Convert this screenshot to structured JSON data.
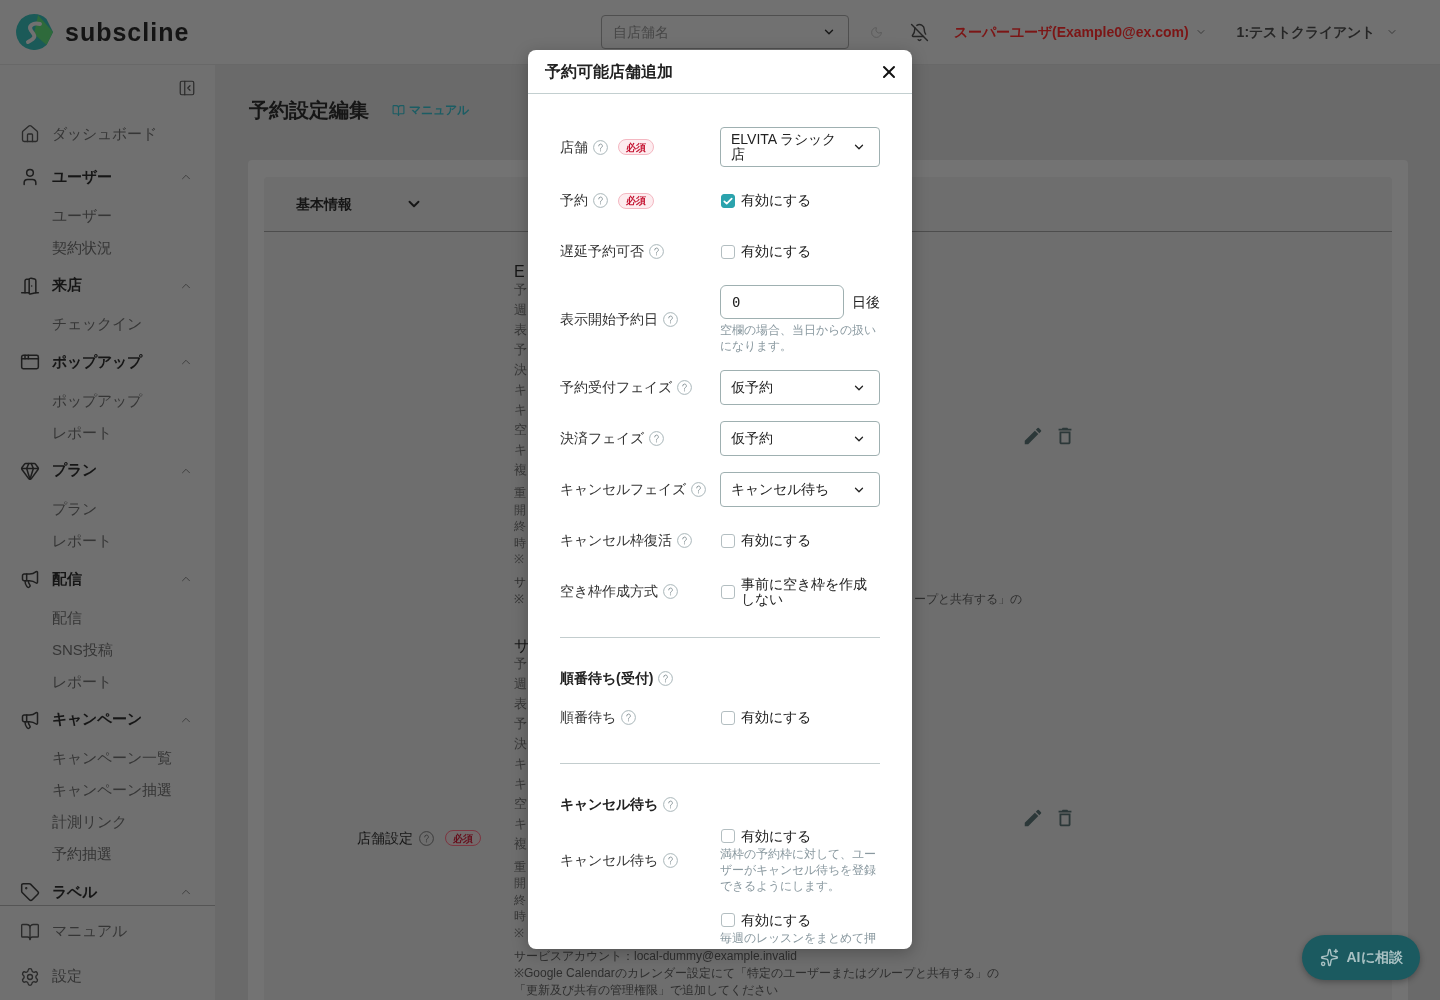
{
  "header": {
    "logo": "subscline",
    "store_select": {
      "placeholder": "自店舗名"
    },
    "user_menu": "スーパーユーザ(Example0@ex.com)",
    "client_menu": "1:テストクライアント"
  },
  "sidebar": {
    "items": [
      {
        "kind": "link",
        "label": "ダッシュボード"
      },
      {
        "kind": "group",
        "label": "ユーザー",
        "expanded": true,
        "children": [
          {
            "label": "ユーザー"
          },
          {
            "label": "契約状況"
          }
        ]
      },
      {
        "kind": "group",
        "label": "来店",
        "expanded": true,
        "children": [
          {
            "label": "チェックイン"
          }
        ]
      },
      {
        "kind": "group",
        "label": "ポップアップ",
        "expanded": true,
        "children": [
          {
            "label": "ポップアップ"
          },
          {
            "label": "レポート"
          }
        ]
      },
      {
        "kind": "group",
        "label": "プラン",
        "expanded": true,
        "children": [
          {
            "label": "プラン"
          },
          {
            "label": "レポート"
          }
        ]
      },
      {
        "kind": "group",
        "label": "配信",
        "expanded": true,
        "children": [
          {
            "label": "配信"
          },
          {
            "label": "SNS投稿"
          },
          {
            "label": "レポート"
          }
        ]
      },
      {
        "kind": "group",
        "label": "キャンペーン",
        "expanded": true,
        "children": [
          {
            "label": "キャンペーン一覧"
          },
          {
            "label": "キャンペーン抽選"
          },
          {
            "label": "計測リンク"
          },
          {
            "label": "予約抽選"
          }
        ]
      },
      {
        "kind": "group",
        "label": "ラベル",
        "expanded": true
      }
    ],
    "footer": [
      {
        "label": "マニュアル"
      },
      {
        "label": "設定"
      }
    ]
  },
  "page": {
    "title": "予約設定編集",
    "manual_link": "マニュアル",
    "panel": {
      "title": "基本情報",
      "field": {
        "label": "店舗設定",
        "badge": "必須"
      },
      "stores": [
        {
          "name": "E",
          "settings": [
            "予",
            "週",
            "表",
            "予",
            "決",
            "キ",
            "キ",
            "空",
            "キ",
            "複"
          ],
          "notes": [
            "重",
            "開",
            "終",
            "時",
            "※"
          ],
          "calendar": [
            {
              "start": "サ"
            },
            {
              "start": "※",
              "end": "ープと共有する」の"
            }
          ]
        },
        {
          "name": "サ",
          "settings": [
            "予",
            "週",
            "表",
            "予",
            "決",
            "キ",
            "キ",
            "空",
            "キ",
            "複"
          ],
          "notes": [
            "重",
            "開",
            "終",
            "時",
            "※"
          ],
          "calendar": [
            {
              "start": "サービスアカウント：local-dummy@example.invalid"
            },
            {
              "start": "※Google Calendarのカレンダー設定にて「特定のユーザーまたはグループと共有する」の"
            },
            {
              "start": "「更新及び共有の管理権限」で追加してください"
            }
          ]
        }
      ]
    }
  },
  "modal": {
    "title": "予約可能店舗追加",
    "sections": [
      {
        "rows": [
          {
            "kind": "select",
            "label": "店舗",
            "badge": "必須",
            "value": "ELVITA ラシック店"
          },
          {
            "kind": "checkbox",
            "label": "予約",
            "badge": "必須",
            "checked": true,
            "text": "有効にする"
          },
          {
            "kind": "checkbox",
            "label": "遅延予約可否",
            "checked": false,
            "text": "有効にする"
          },
          {
            "kind": "number",
            "label": "表示開始予約日",
            "value": "0",
            "suffix": "日後",
            "hint": "空欄の場合、当日からの扱いになります。"
          },
          {
            "kind": "select",
            "label": "予約受付フェイズ",
            "value": "仮予約"
          },
          {
            "kind": "select",
            "label": "決済フェイズ",
            "value": "仮予約"
          },
          {
            "kind": "select",
            "label": "キャンセルフェイズ",
            "value": "キャンセル待ち"
          },
          {
            "kind": "checkbox",
            "label": "キャンセル枠復活",
            "checked": false,
            "text": "有効にする"
          },
          {
            "kind": "checkbox",
            "label": "空き枠作成方式",
            "checked": false,
            "text": "事前に空き枠を作成しない"
          }
        ]
      },
      {
        "heading": "順番待ち(受付)",
        "rows": [
          {
            "kind": "checkbox",
            "label": "順番待ち",
            "checked": false,
            "text": "有効にする"
          }
        ]
      },
      {
        "heading": "キャンセル待ち",
        "rows": [
          {
            "kind": "checkbox",
            "label": "キャンセル待ち",
            "checked": false,
            "text": "有効にする",
            "hint": "満枠の予約枠に対して、ユーザーがキャンセル待ちを登録できるようにします。"
          },
          {
            "kind": "checkbox",
            "checked": false,
            "text": "有効にする",
            "hint": "毎週のレッスンをまとめて押"
          }
        ]
      }
    ]
  },
  "assistant_button": "AIに相談"
}
